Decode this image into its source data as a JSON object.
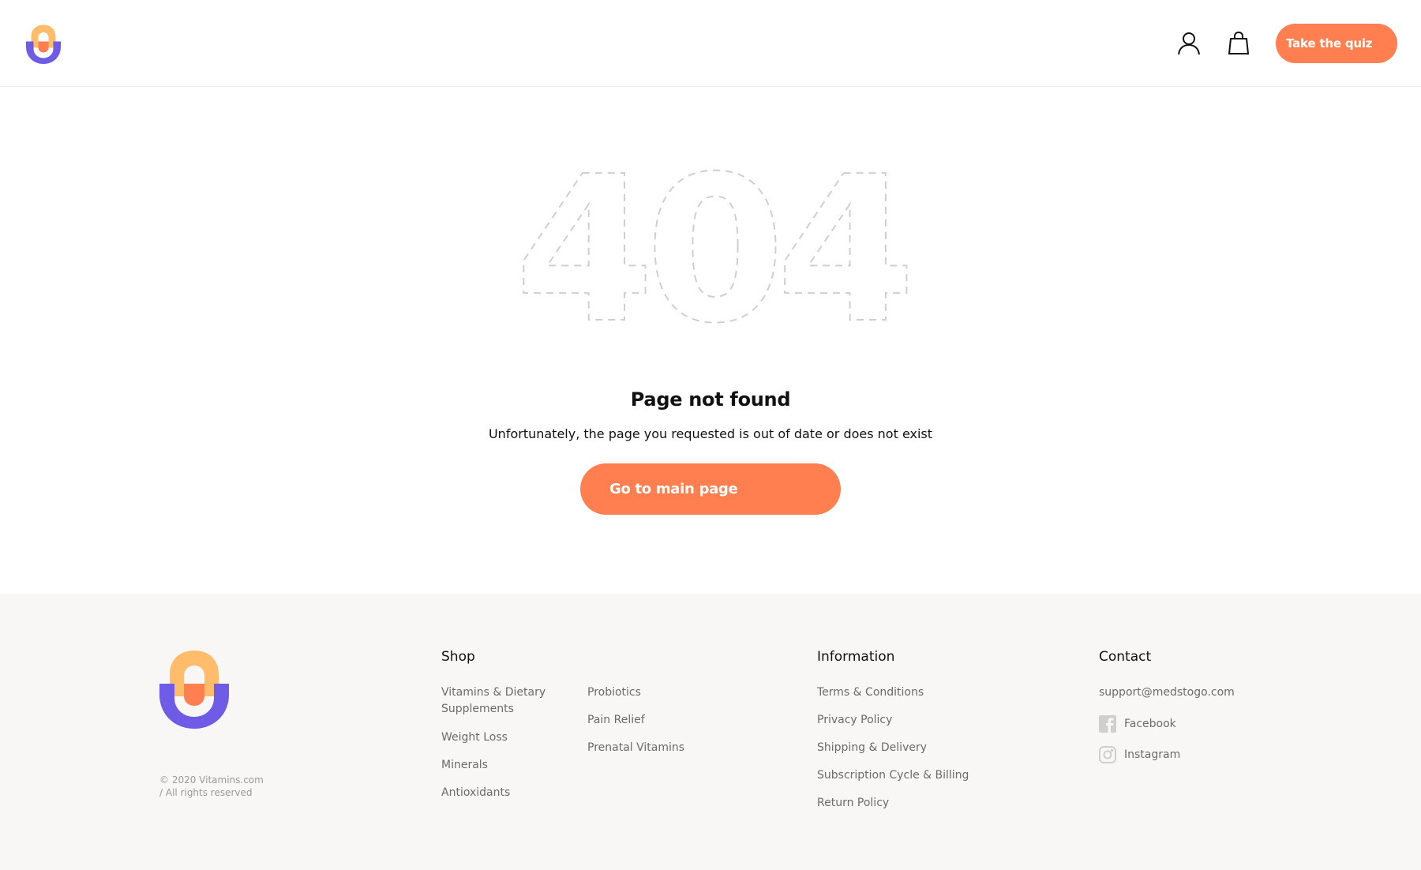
{
  "header": {
    "quiz_button": "Take the quiz"
  },
  "main": {
    "error_code": "404",
    "title": "Page not found",
    "subtitle": "Unfortunately, the page you requested is out of date or does not exist",
    "button": "Go to main page"
  },
  "footer": {
    "copyright_line1": "© 2020 Vitamins.com",
    "copyright_line2": "/ All rights reserved",
    "shop": {
      "title": "Shop",
      "col1": [
        "Vitamins & Dietary Supplements",
        "Weight Loss",
        "Minerals",
        "Antioxidants"
      ],
      "col2": [
        "Probiotics",
        "Pain Relief",
        "Prenatal Vitamins"
      ]
    },
    "information": {
      "title": "Information",
      "links": [
        "Terms & Conditions",
        "Privacy Policy",
        "Shipping & Delivery",
        "Subscription Cycle & Billing",
        "Return Policy"
      ]
    },
    "contact": {
      "title": "Contact",
      "email": "support@medstogo.com",
      "facebook": "Facebook",
      "instagram": "Instagram"
    }
  },
  "colors": {
    "accent": "#ff7f50",
    "logo_yellow": "#ffbd6b",
    "logo_purple": "#6e5ce6",
    "footer_bg": "#f8f7f5"
  },
  "icons": {
    "user": "user-icon",
    "bag": "shopping-bag-icon",
    "facebook": "facebook-icon",
    "instagram": "instagram-icon"
  }
}
